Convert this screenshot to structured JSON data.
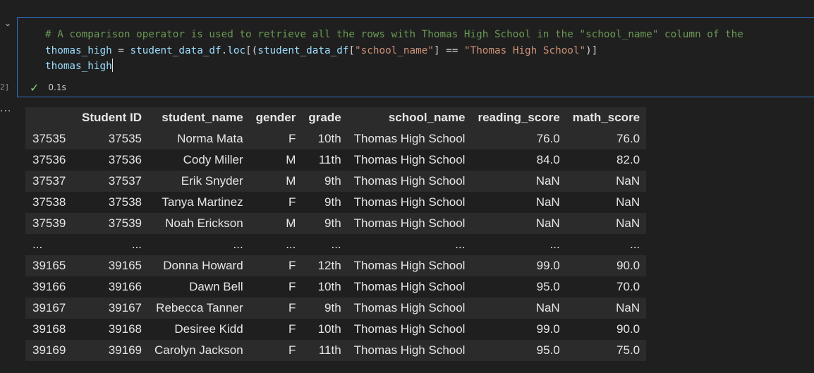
{
  "cell": {
    "execution_count": "2]",
    "code_lines": [
      [
        {
          "t": "comment",
          "v": "# A comparison operator is used to retrieve all the rows with Thomas High School in the \"school_name\" column of the"
        }
      ],
      [
        {
          "t": "var",
          "v": "thomas_high"
        },
        {
          "t": "op",
          "v": " = "
        },
        {
          "t": "var",
          "v": "student_data_df"
        },
        {
          "t": "op",
          "v": "."
        },
        {
          "t": "var",
          "v": "loc"
        },
        {
          "t": "op",
          "v": "[("
        },
        {
          "t": "var",
          "v": "student_data_df"
        },
        {
          "t": "op",
          "v": "["
        },
        {
          "t": "str",
          "v": "\"school_name\""
        },
        {
          "t": "op",
          "v": "] == "
        },
        {
          "t": "str",
          "v": "\"Thomas High School\""
        },
        {
          "t": "op",
          "v": ")]"
        }
      ],
      [
        {
          "t": "var",
          "v": "thomas_high"
        },
        {
          "t": "cursor",
          "v": ""
        }
      ]
    ],
    "status_time": "0.1s",
    "output_marker": "..."
  },
  "table": {
    "index_header": "",
    "columns": [
      "Student ID",
      "student_name",
      "gender",
      "grade",
      "school_name",
      "reading_score",
      "math_score"
    ],
    "rows": [
      [
        "37535",
        "37535",
        "Norma Mata",
        "F",
        "10th",
        "Thomas High School",
        "76.0",
        "76.0"
      ],
      [
        "37536",
        "37536",
        "Cody Miller",
        "M",
        "11th",
        "Thomas High School",
        "84.0",
        "82.0"
      ],
      [
        "37537",
        "37537",
        "Erik Snyder",
        "M",
        "9th",
        "Thomas High School",
        "NaN",
        "NaN"
      ],
      [
        "37538",
        "37538",
        "Tanya Martinez",
        "F",
        "9th",
        "Thomas High School",
        "NaN",
        "NaN"
      ],
      [
        "37539",
        "37539",
        "Noah Erickson",
        "M",
        "9th",
        "Thomas High School",
        "NaN",
        "NaN"
      ],
      [
        "...",
        "...",
        "...",
        "...",
        "...",
        "...",
        "...",
        "..."
      ],
      [
        "39165",
        "39165",
        "Donna Howard",
        "F",
        "12th",
        "Thomas High School",
        "99.0",
        "90.0"
      ],
      [
        "39166",
        "39166",
        "Dawn Bell",
        "F",
        "10th",
        "Thomas High School",
        "95.0",
        "70.0"
      ],
      [
        "39167",
        "39167",
        "Rebecca Tanner",
        "F",
        "9th",
        "Thomas High School",
        "NaN",
        "NaN"
      ],
      [
        "39168",
        "39168",
        "Desiree Kidd",
        "F",
        "10th",
        "Thomas High School",
        "99.0",
        "90.0"
      ],
      [
        "39169",
        "39169",
        "Carolyn Jackson",
        "F",
        "11th",
        "Thomas High School",
        "95.0",
        "75.0"
      ]
    ]
  }
}
